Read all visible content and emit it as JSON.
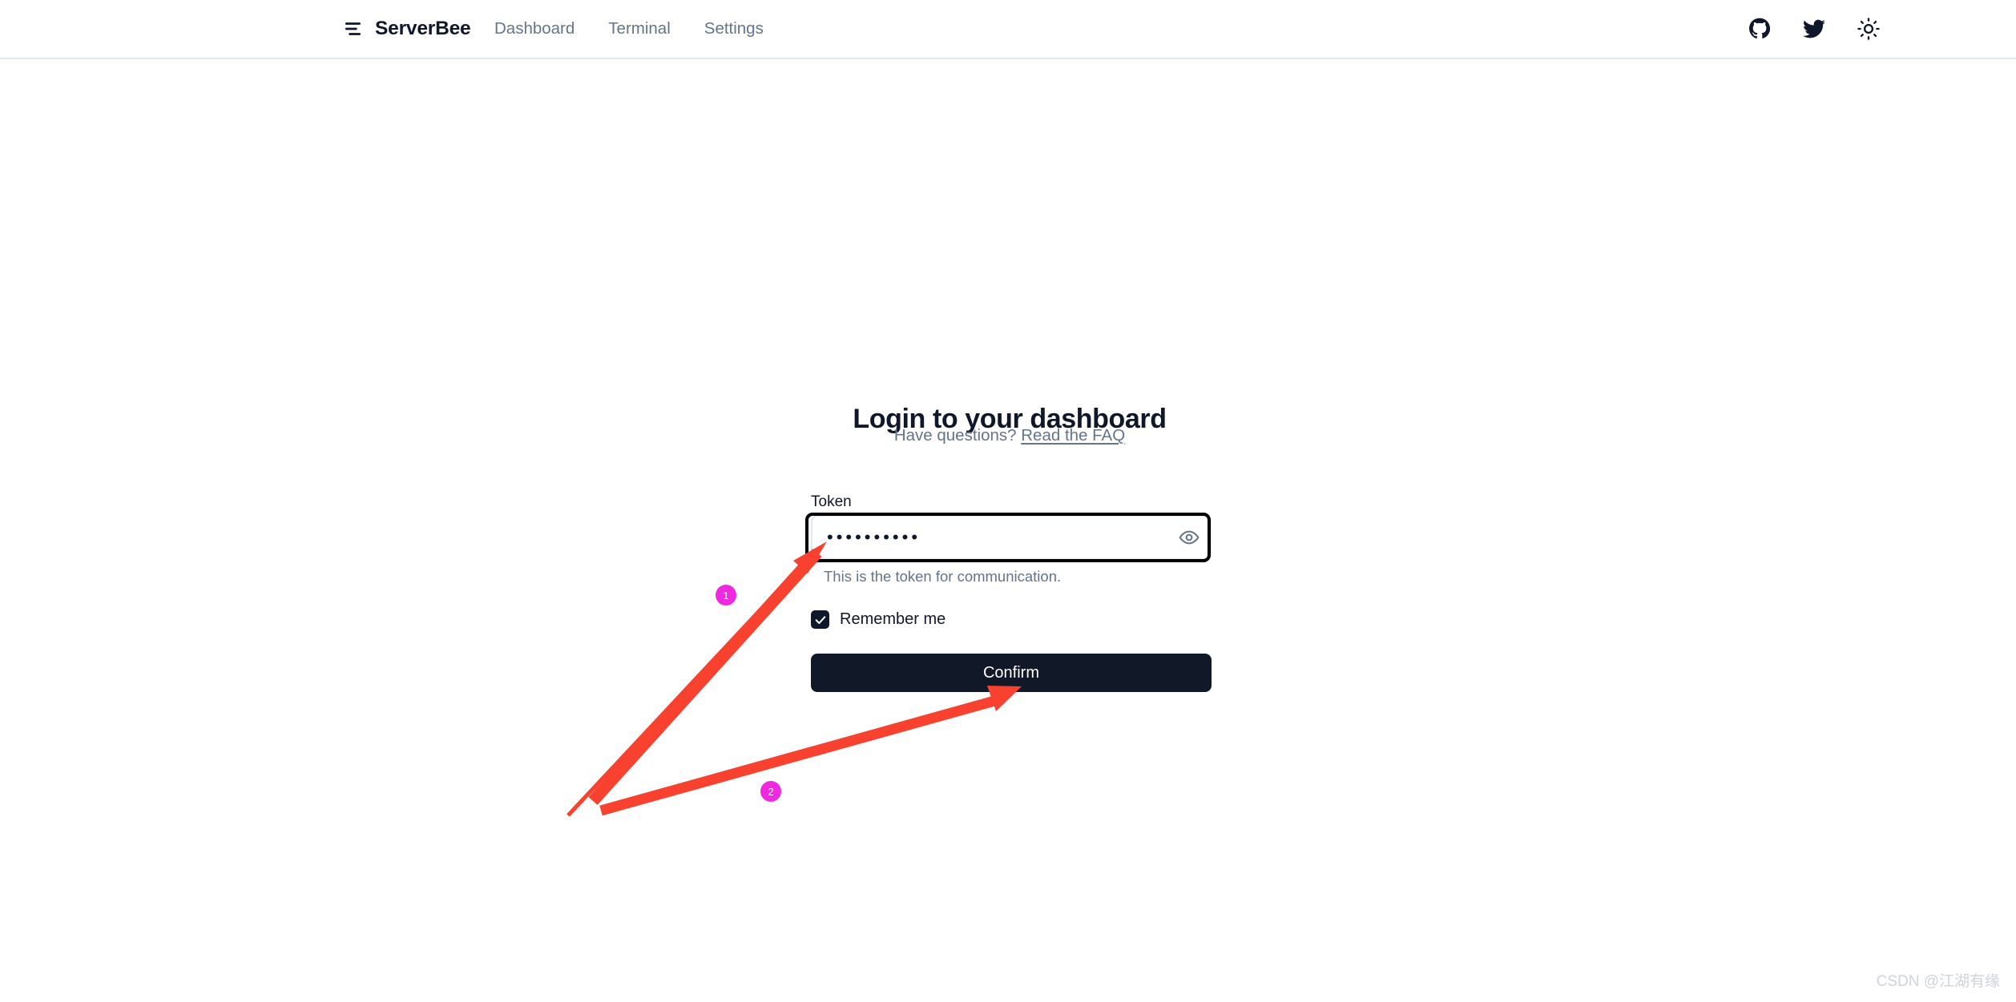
{
  "header": {
    "brand": {
      "name": "ServerBee",
      "icon": "stacked-lines-logo-icon"
    },
    "nav": [
      {
        "label": "Dashboard",
        "name": "nav-link-dashboard"
      },
      {
        "label": "Terminal",
        "name": "nav-link-terminal"
      },
      {
        "label": "Settings",
        "name": "nav-link-settings"
      }
    ],
    "icons": [
      {
        "name": "github-icon",
        "title": "GitHub"
      },
      {
        "name": "twitter-icon",
        "title": "Twitter"
      },
      {
        "name": "sun-theme-toggle-icon",
        "title": "Toggle theme"
      }
    ]
  },
  "login": {
    "title": "Login to your dashboard",
    "subtitle_prefix": "Have questions?",
    "faq_link": "Read the FAQ",
    "token_label": "Token",
    "token_value": "••••••••••",
    "token_placeholder": "Token",
    "token_help": "This is the token for communication.",
    "eye_icon": "eye-visibility-icon",
    "remember_label": "Remember me",
    "remember_checked": true,
    "confirm_label": "Confirm"
  },
  "annotations": {
    "markers": [
      {
        "label": "1",
        "target": "token-input"
      },
      {
        "label": "2",
        "target": "confirm-button"
      }
    ],
    "arrow_color": "#f8412e",
    "marker_color": "#ef29e0",
    "box_color": "#000000"
  },
  "watermark": "CSDN @江湖有缘",
  "colors": {
    "text_primary": "#0f172a",
    "text_muted": "#64748b",
    "border": "#e2e8f0",
    "button_bg": "#111827",
    "page_bg": "#ffffff"
  }
}
